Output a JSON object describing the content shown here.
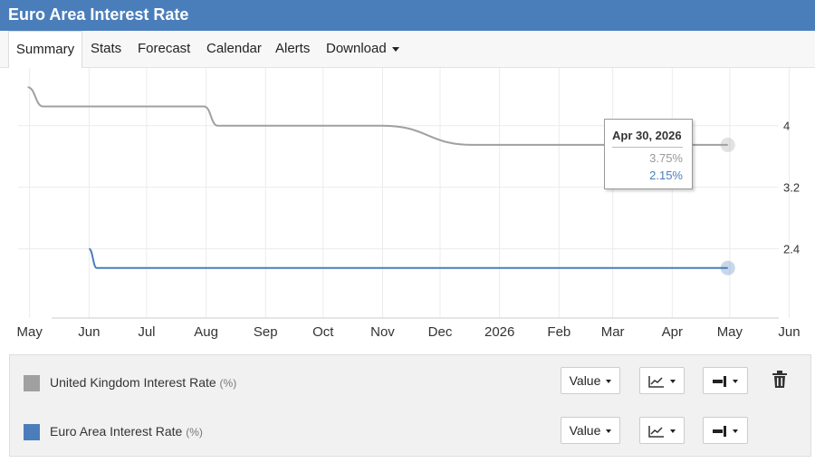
{
  "title": "Euro Area Interest Rate",
  "tabs": [
    {
      "label": "Summary"
    },
    {
      "label": "Stats"
    },
    {
      "label": "Forecast"
    },
    {
      "label": "Calendar"
    },
    {
      "label": "Alerts"
    },
    {
      "label": "Download"
    }
  ],
  "tooltip": {
    "date": "Apr 30, 2026",
    "value1": "3.75%",
    "value2": "2.15%"
  },
  "colors": {
    "uk": "#a0a0a0",
    "ea": "#4a7ebb",
    "header": "#4a7ebb"
  },
  "legend": [
    {
      "label": "United Kingdom Interest Rate",
      "unit": "(%)",
      "color": "#a0a0a0",
      "value_label": "Value"
    },
    {
      "label": "Euro Area Interest Rate",
      "unit": "(%)",
      "color": "#4a7ebb",
      "value_label": "Value"
    }
  ],
  "icons": {
    "chart_type": "line-chart-icon",
    "axis": "axis-icon",
    "delete": "trash-icon"
  },
  "chart_data": {
    "type": "line",
    "x_ticks": [
      "May",
      "Jun",
      "Jul",
      "Aug",
      "Sep",
      "Oct",
      "Nov",
      "Dec",
      "2026",
      "Feb",
      "Mar",
      "Apr",
      "May",
      "Jun"
    ],
    "y_ticks": [
      "4",
      "3.2",
      "2.4"
    ],
    "ylim": [
      1.5,
      4.75
    ],
    "x_range": [
      "2025-04-25",
      "2026-06-05"
    ],
    "grid": true,
    "series": [
      {
        "name": "United Kingdom Interest Rate",
        "color": "#a0a0a0",
        "points": [
          [
            "2025-04-30",
            4.5
          ],
          [
            "2025-05-08",
            4.25
          ],
          [
            "2025-07-31",
            4.25
          ],
          [
            "2025-08-07",
            4.0
          ],
          [
            "2025-11-01",
            4.0
          ],
          [
            "2025-12-18",
            3.75
          ],
          [
            "2026-04-30",
            3.75
          ]
        ]
      },
      {
        "name": "Euro Area Interest Rate",
        "color": "#4a7ebb",
        "points": [
          [
            "2025-06-01",
            2.4
          ],
          [
            "2025-06-05",
            2.15
          ],
          [
            "2026-04-30",
            2.15
          ]
        ]
      }
    ]
  }
}
